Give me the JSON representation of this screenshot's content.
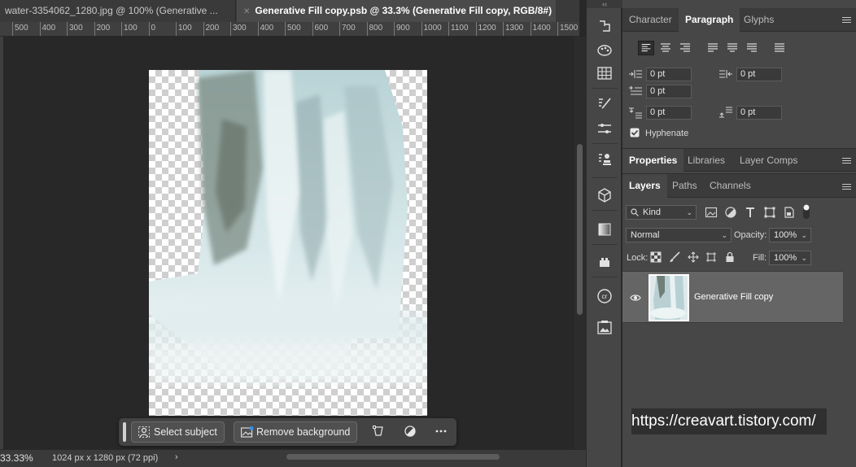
{
  "document_tabs": [
    {
      "label": "water-3354062_1280.jpg @ 100% (Generative ...",
      "active": false
    },
    {
      "label": "Generative Fill copy.psb @ 33.3% (Generative Fill copy, RGB/8#)",
      "active": true
    }
  ],
  "ruler": {
    "ticks": [
      "500",
      "400",
      "300",
      "200",
      "100",
      "0",
      "100",
      "200",
      "300",
      "400",
      "500",
      "600",
      "700",
      "800",
      "900",
      "1000",
      "1100",
      "1200",
      "1300",
      "1400",
      "1500"
    ]
  },
  "taskbar": {
    "select_subject": "Select subject",
    "remove_background": "Remove background",
    "icons": [
      "transform-icon",
      "adjustment-icon",
      "more-icon"
    ]
  },
  "status": {
    "zoom": "33.33%",
    "doc_size": "1024 px x 1280 px (72 ppi)",
    "arrow": "›"
  },
  "type_panel": {
    "tabs": [
      "Character",
      "Paragraph",
      "Glyphs"
    ],
    "active_tab": "Paragraph",
    "indent_left": "0 pt",
    "indent_right": "0 pt",
    "indent_first_line": "0 pt",
    "space_before": "0 pt",
    "space_after": "0 pt",
    "hyphenate_label": "Hyphenate",
    "hyphenate_checked": true
  },
  "properties_panel": {
    "tabs": [
      "Properties",
      "Libraries",
      "Layer Comps"
    ],
    "active_tab": "Properties"
  },
  "layers_panel": {
    "tabs": [
      "Layers",
      "Paths",
      "Channels"
    ],
    "active_tab": "Layers",
    "filter_kind": "Kind",
    "blend_mode": "Normal",
    "opacity_label": "Opacity:",
    "opacity_value": "100%",
    "lock_label": "Lock:",
    "fill_label": "Fill:",
    "fill_value": "100%",
    "layers": [
      {
        "name": "Generative Fill copy",
        "visible": true,
        "selected": true
      }
    ]
  },
  "watermark": "https://creavart.tistory.com/",
  "colors": {
    "app_bg": "#282828",
    "panel_bg": "#474747",
    "tab_bar": "#3b3b3b",
    "selected_layer": "#656565",
    "water_tint": "#c9dde0"
  }
}
